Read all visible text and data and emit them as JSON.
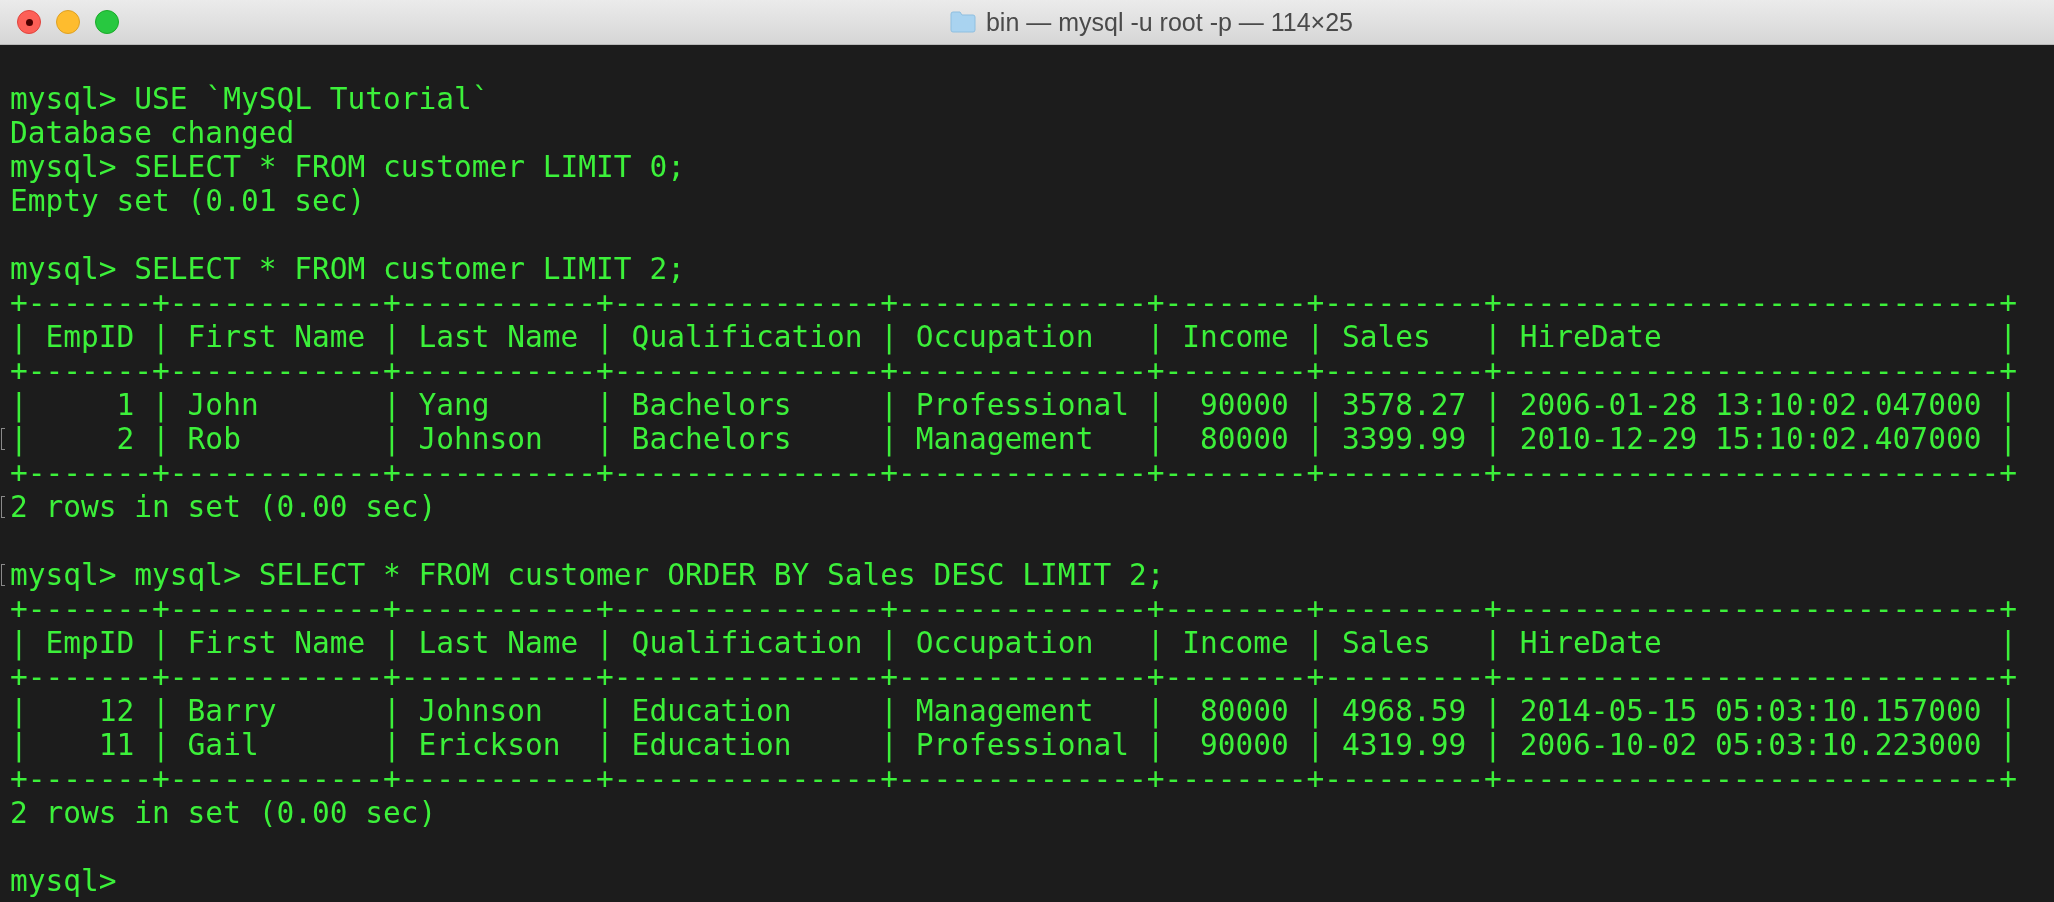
{
  "window": {
    "title": "bin — mysql -u root -p — 114×25"
  },
  "lines": [
    {
      "kind": "blank"
    },
    {
      "kind": "prompt",
      "text": "mysql> USE `MySQL Tutorial`",
      "marked": false
    },
    {
      "kind": "output",
      "text": "Database changed",
      "marked": false
    },
    {
      "kind": "prompt",
      "text": "mysql> SELECT * FROM customer LIMIT 0;",
      "marked": false
    },
    {
      "kind": "output",
      "text": "Empty set (0.01 sec)",
      "marked": false
    },
    {
      "kind": "blank"
    },
    {
      "kind": "prompt",
      "text": "mysql> SELECT * FROM customer LIMIT 2;",
      "marked": false
    },
    {
      "kind": "table",
      "text": "+-------+------------+-----------+---------------+--------------+--------+---------+----------------------------+",
      "marked": false
    },
    {
      "kind": "table",
      "text": "| EmpID | First Name | Last Name | Qualification | Occupation   | Income | Sales   | HireDate                   |",
      "marked": false
    },
    {
      "kind": "table",
      "text": "+-------+------------+-----------+---------------+--------------+--------+---------+----------------------------+",
      "marked": false
    },
    {
      "kind": "table",
      "text": "|     1 | John       | Yang      | Bachelors     | Professional |  90000 | 3578.27 | 2006-01-28 13:10:02.047000 |",
      "marked": false
    },
    {
      "kind": "table",
      "text": "|     2 | Rob        | Johnson   | Bachelors     | Management   |  80000 | 3399.99 | 2010-12-29 15:10:02.407000 |",
      "marked": true
    },
    {
      "kind": "table",
      "text": "+-------+------------+-----------+---------------+--------------+--------+---------+----------------------------+",
      "marked": false
    },
    {
      "kind": "output",
      "text": "2 rows in set (0.00 sec)",
      "marked": true
    },
    {
      "kind": "blank"
    },
    {
      "kind": "prompt",
      "text": "mysql> mysql> SELECT * FROM customer ORDER BY Sales DESC LIMIT 2;",
      "marked": true
    },
    {
      "kind": "table",
      "text": "+-------+------------+-----------+---------------+--------------+--------+---------+----------------------------+",
      "marked": false
    },
    {
      "kind": "table",
      "text": "| EmpID | First Name | Last Name | Qualification | Occupation   | Income | Sales   | HireDate                   |",
      "marked": false
    },
    {
      "kind": "table",
      "text": "+-------+------------+-----------+---------------+--------------+--------+---------+----------------------------+",
      "marked": false
    },
    {
      "kind": "table",
      "text": "|    12 | Barry      | Johnson   | Education     | Management   |  80000 | 4968.59 | 2014-05-15 05:03:10.157000 |",
      "marked": false
    },
    {
      "kind": "table",
      "text": "|    11 | Gail       | Erickson  | Education     | Professional |  90000 | 4319.99 | 2006-10-02 05:03:10.223000 |",
      "marked": false
    },
    {
      "kind": "table",
      "text": "+-------+------------+-----------+---------------+--------------+--------+---------+----------------------------+",
      "marked": false
    },
    {
      "kind": "output",
      "text": "2 rows in set (0.00 sec)",
      "marked": false
    },
    {
      "kind": "blank"
    },
    {
      "kind": "prompt",
      "text": "mysql>",
      "marked": false
    }
  ]
}
